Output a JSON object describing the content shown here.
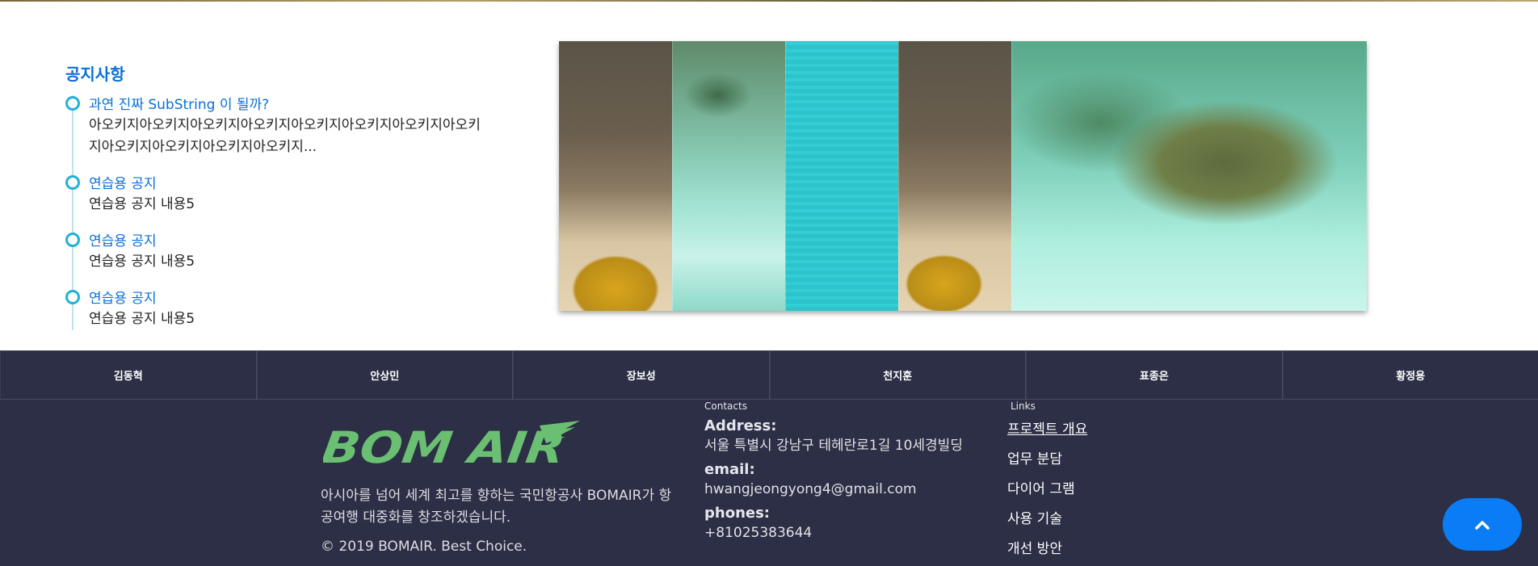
{
  "notice": {
    "title": "공지사항",
    "items": [
      {
        "title": "과연 진짜 SubString 이 될까?",
        "body": "아오키지아오키지아오키지아오키지아오키지아오키지아오키지아오키지아오키지아오키지아오키지아오키지..."
      },
      {
        "title": "연습용 공지",
        "body": "연습용 공지 내용5"
      },
      {
        "title": "연습용 공지",
        "body": "연습용 공지 내용5"
      },
      {
        "title": "연습용 공지",
        "body": "연습용 공지 내용5"
      }
    ]
  },
  "members": [
    "김동혁",
    "안상민",
    "장보성",
    "천지훈",
    "표종은",
    "황정용"
  ],
  "footer": {
    "logo_text": "BOM AIR",
    "about": "아시아를 넘어 세계 최고를 향하는 국민항공사 BOMAIR가 항공여행 대중화를 창조하겠습니다.",
    "copyright": "© 2019 BOMAIR. Best Choice.",
    "contacts": {
      "label": "Contacts",
      "address_label": "Address:",
      "address": "서울 특별시 강남구 테헤란로1길 10세경빌딩",
      "email_label": "email:",
      "email": "hwangjeongyong4@gmail.com",
      "phones_label": "phones:",
      "phone": "+81025383644"
    },
    "links": {
      "label": "Links",
      "items": [
        "프로젝트 개요",
        "업무 분담",
        "다이어 그램",
        "사용 기술",
        "개선 방안"
      ]
    }
  },
  "colors": {
    "accent": "#0a6fd6",
    "footer_bg": "#2c2f45",
    "logo_green": "#6abf72",
    "to_top": "#0a7cf5"
  },
  "icons": {
    "to_top": "chevron-up-icon"
  }
}
